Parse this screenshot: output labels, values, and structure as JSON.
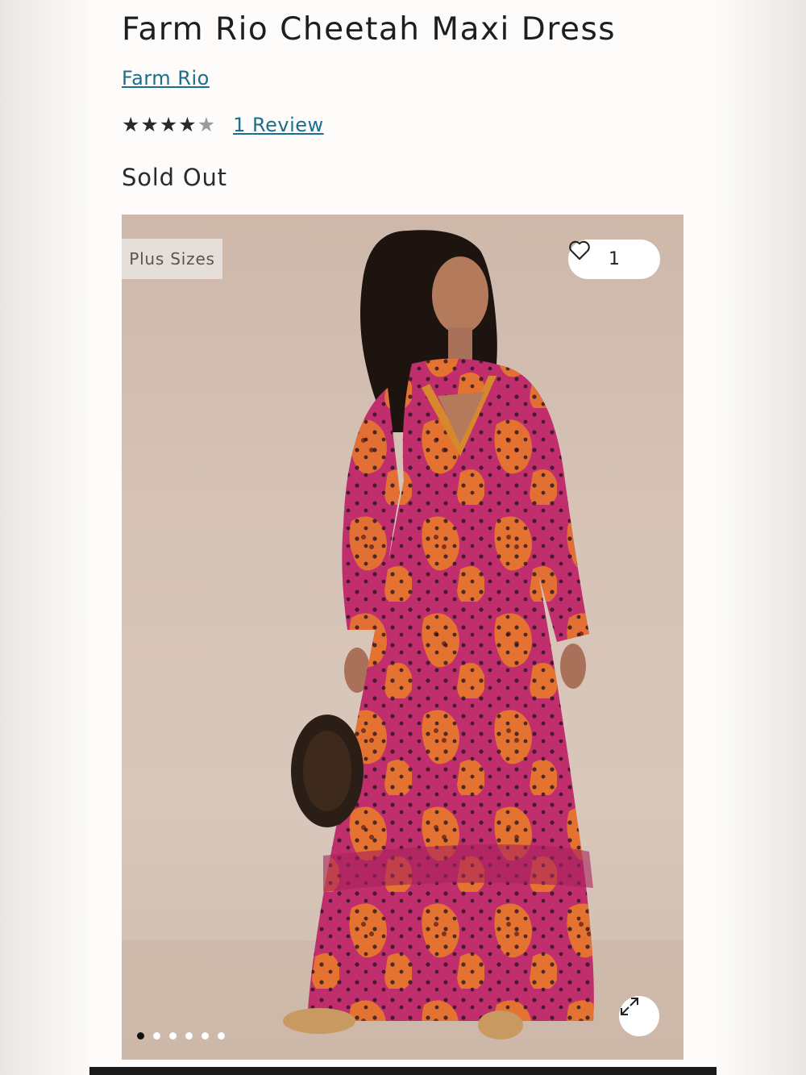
{
  "product": {
    "title": "Farm Rio Cheetah Maxi Dress",
    "brand": "Farm Rio",
    "rating": 4,
    "rating_max": 5,
    "reviews_label": "1 Review",
    "status": "Sold Out"
  },
  "gallery": {
    "badge": "Plus Sizes",
    "favorite_count": "1",
    "image_count": 6,
    "active_index": 0
  },
  "colors": {
    "link": "#1c6f8c",
    "dress": "#c02e6e",
    "print": "#e87a2a",
    "backdrop": "#d6c3b6"
  },
  "icons": {
    "favorite": "heart-icon",
    "expand": "expand-icon",
    "rating": "star-icon"
  }
}
